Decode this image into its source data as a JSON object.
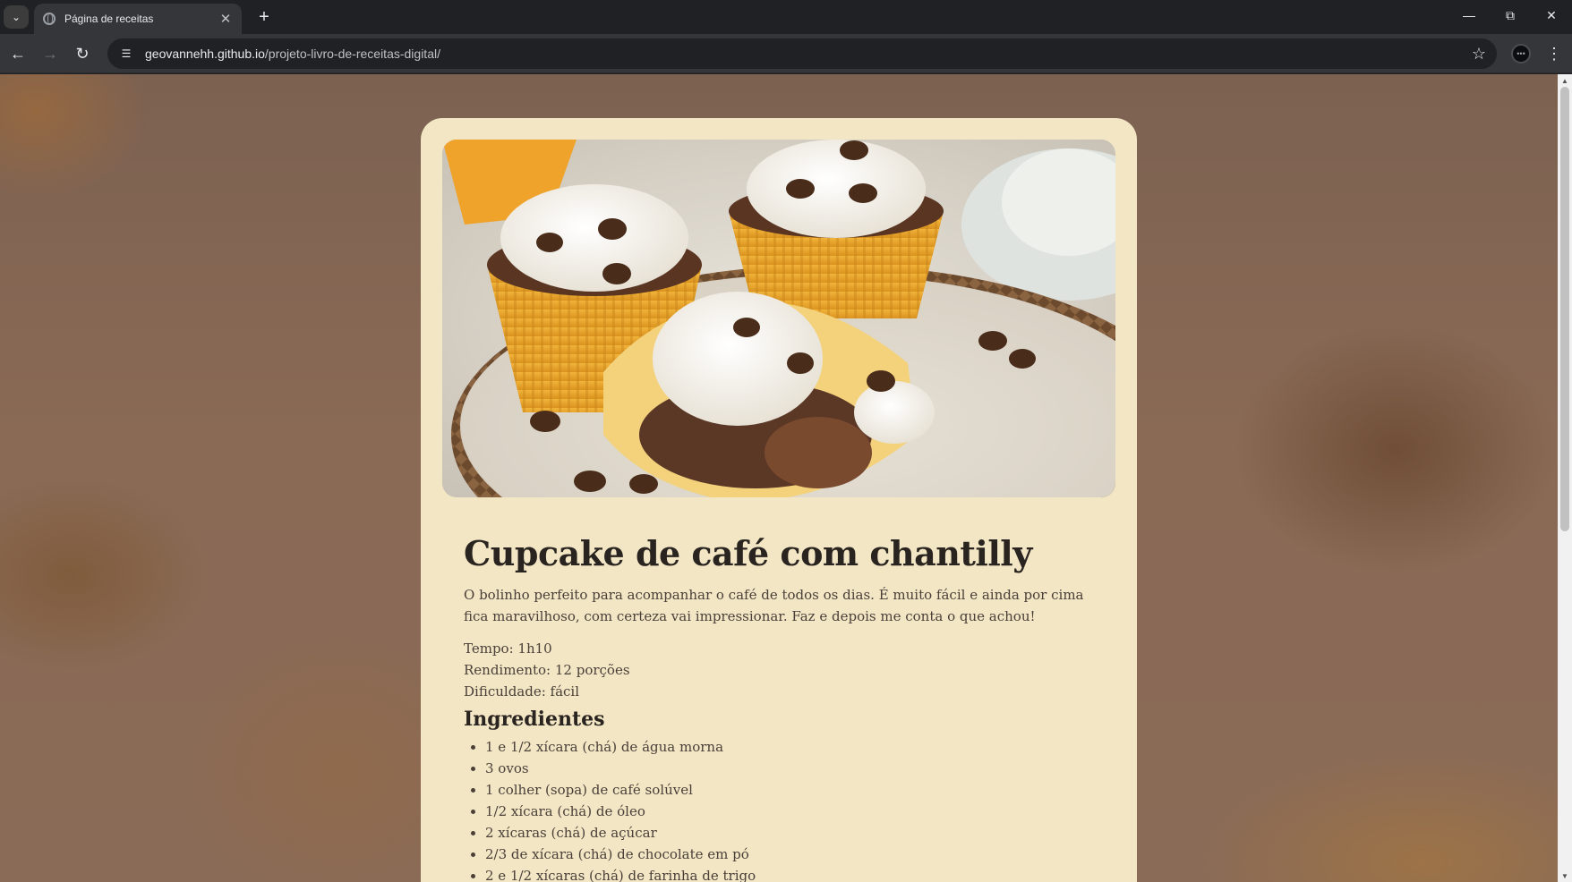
{
  "browser": {
    "tab_title": "Página de receitas",
    "url_host": "geovannehh.github.io",
    "url_path": "/projeto-livro-de-receitas-digital/",
    "icons": {
      "tab_menu": "chevron-down-icon",
      "new_tab": "plus-icon",
      "back": "back-arrow-icon",
      "forward": "forward-arrow-icon",
      "reload": "reload-icon",
      "site_info": "tune-icon",
      "bookmark": "star-icon",
      "menu": "kebab-icon"
    }
  },
  "recipe": {
    "image_description_alt": "",
    "title": "Cupcake de café com chantilly",
    "intro": "O bolinho perfeito para acompanhar o café de todos os dias. É muito fácil e ainda por cima fica maravilhoso, com certeza vai impressionar. Faz e depois me conta o que achou!",
    "meta": {
      "time": "Tempo: 1h10",
      "yield": "Rendimento: 12 porções",
      "difficulty": "Dificuldade: fácil"
    },
    "ingredients_title": "Ingredientes",
    "ingredients": [
      "1 e 1/2 xícara (chá) de água morna",
      "3 ovos",
      "1 colher (sopa) de café solúvel",
      "1/2 xícara (chá) de óleo",
      "2 xícaras (chá) de açúcar",
      "2/3 de xícara (chá) de chocolate em pó",
      "2 e 1/2 xícaras (chá) de farinha de trigo"
    ]
  },
  "colors": {
    "card_background": "#f2e6c4",
    "page_background": "#8a6a55",
    "title_text": "#2a2420"
  }
}
